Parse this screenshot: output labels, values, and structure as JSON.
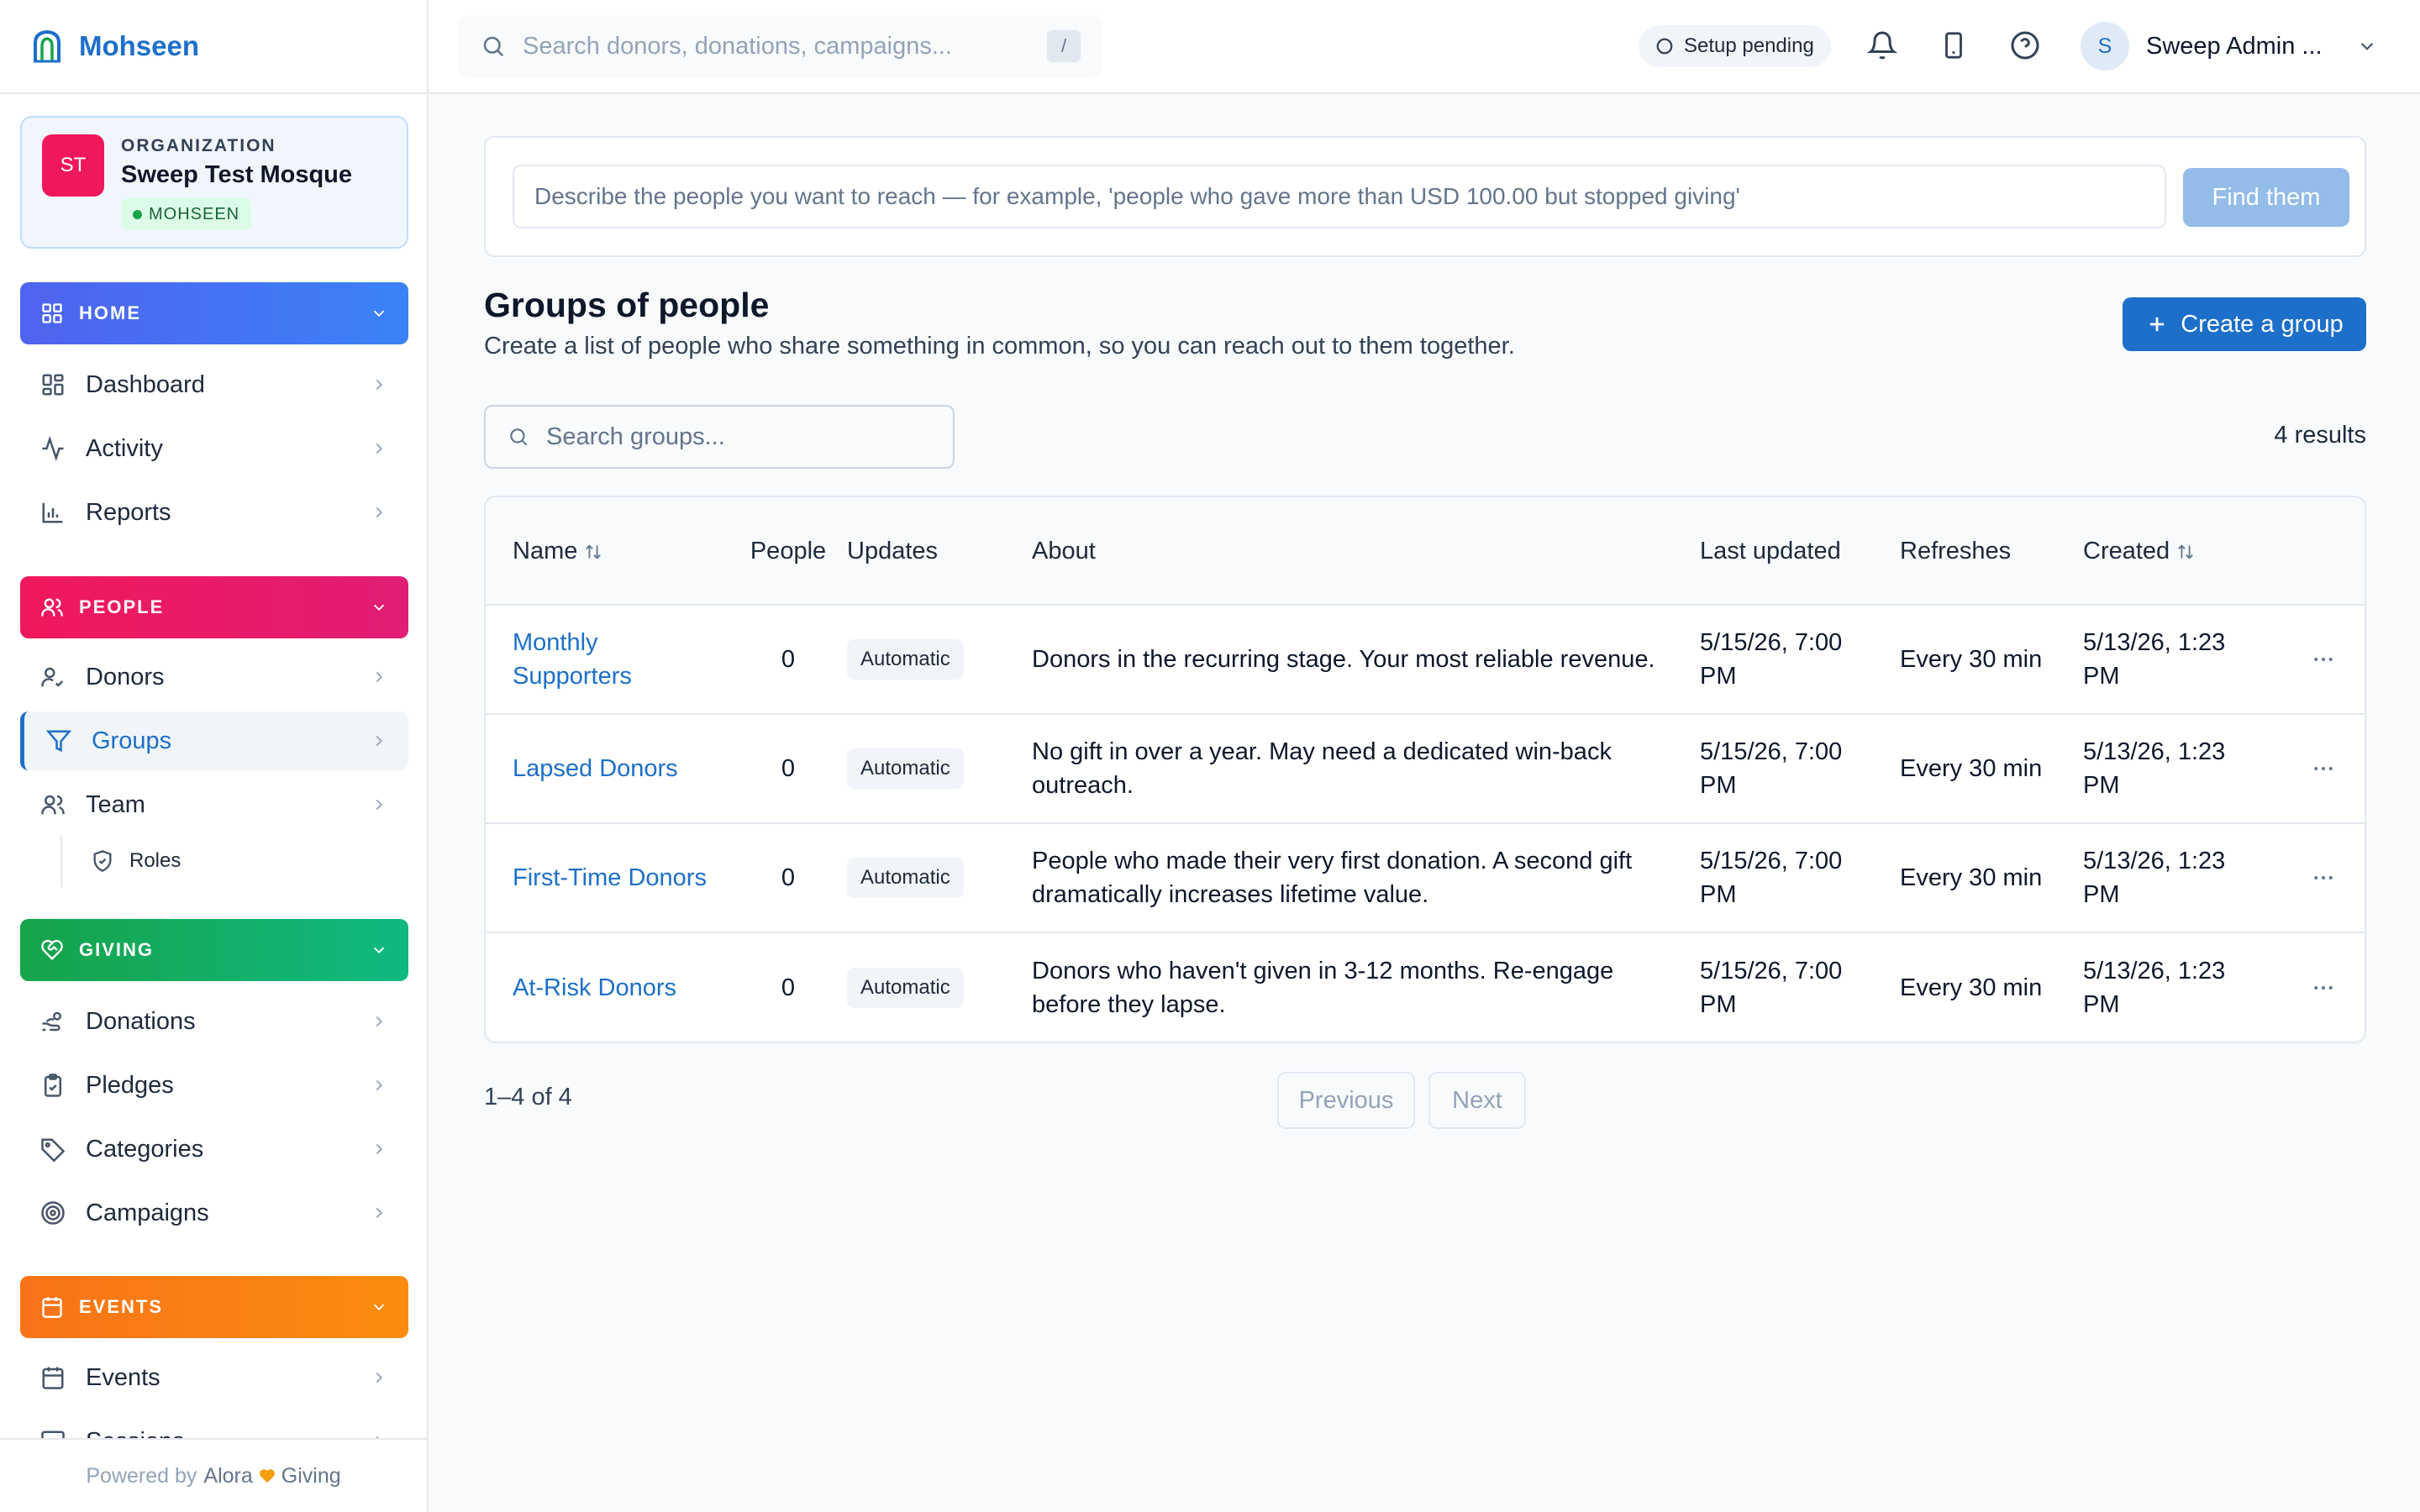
{
  "brand": {
    "name": "Mohseen"
  },
  "org": {
    "initials": "ST",
    "label": "ORGANIZATION",
    "name": "Sweep Test Mosque",
    "badge": "MOHSEEN"
  },
  "colors": {
    "accent": "#1d6fc9",
    "home": "#4f63f0",
    "people": "#f0185c",
    "giving": "#16a34a",
    "events": "#fb7a10"
  },
  "sidebar": {
    "home": {
      "title": "HOME",
      "items": [
        {
          "label": "Dashboard",
          "icon": "grid-icon"
        },
        {
          "label": "Activity",
          "icon": "activity-icon"
        },
        {
          "label": "Reports",
          "icon": "bar-chart-icon"
        }
      ]
    },
    "people": {
      "title": "PEOPLE",
      "items": [
        {
          "label": "Donors",
          "icon": "user-check-icon"
        },
        {
          "label": "Groups",
          "icon": "filter-icon",
          "active": true
        },
        {
          "label": "Team",
          "icon": "users-icon"
        }
      ],
      "sub": [
        {
          "label": "Roles",
          "icon": "shield-icon"
        }
      ]
    },
    "giving": {
      "title": "GIVING",
      "items": [
        {
          "label": "Donations",
          "icon": "hand-coins-icon"
        },
        {
          "label": "Pledges",
          "icon": "clipboard-check-icon"
        },
        {
          "label": "Categories",
          "icon": "tag-icon"
        },
        {
          "label": "Campaigns",
          "icon": "target-icon"
        }
      ]
    },
    "events": {
      "title": "EVENTS",
      "items": [
        {
          "label": "Events",
          "icon": "calendar-icon"
        },
        {
          "label": "Sessions",
          "icon": "monitor-icon"
        }
      ]
    },
    "footer": {
      "prefix": "Powered by",
      "brand1": "Alora",
      "brand2": "Giving"
    }
  },
  "topbar": {
    "search_placeholder": "Search donors, donations, campaigns...",
    "search_shortcut": "/",
    "setup_status": "Setup pending",
    "user_initial": "S",
    "user_name": "Sweep Admin ..."
  },
  "ai_search": {
    "placeholder": "Describe the people you want to reach — for example, 'people who gave more than USD 100.00 but stopped giving'",
    "button": "Find them"
  },
  "page": {
    "title": "Groups of people",
    "subtitle": "Create a list of people who share something in common, so you can reach out to them together.",
    "create_button": "Create a group",
    "search_placeholder": "Search groups...",
    "results": "4 results"
  },
  "table": {
    "headers": {
      "name": "Name",
      "people": "People",
      "updates": "Updates",
      "about": "About",
      "last_updated": "Last updated",
      "refreshes": "Refreshes",
      "created": "Created"
    },
    "rows": [
      {
        "name": "Monthly Supporters",
        "people": "0",
        "updates": "Automatic",
        "about": "Donors in the recurring stage. Your most reliable revenue.",
        "last_updated": "5/15/26, 7:00 PM",
        "refreshes": "Every 30 min",
        "created": "5/13/26, 1:23 PM"
      },
      {
        "name": "Lapsed Donors",
        "people": "0",
        "updates": "Automatic",
        "about": "No gift in over a year. May need a dedicated win-back outreach.",
        "last_updated": "5/15/26, 7:00 PM",
        "refreshes": "Every 30 min",
        "created": "5/13/26, 1:23 PM"
      },
      {
        "name": "First-Time Donors",
        "people": "0",
        "updates": "Automatic",
        "about": "People who made their very first donation. A second gift dramatically increases lifetime value.",
        "last_updated": "5/15/26, 7:00 PM",
        "refreshes": "Every 30 min",
        "created": "5/13/26, 1:23 PM"
      },
      {
        "name": "At-Risk Donors",
        "people": "0",
        "updates": "Automatic",
        "about": "Donors who haven't given in 3-12 months. Re-engage before they lapse.",
        "last_updated": "5/15/26, 7:00 PM",
        "refreshes": "Every 30 min",
        "created": "5/13/26, 1:23 PM"
      }
    ]
  },
  "pagination": {
    "info": "1–4 of 4",
    "previous": "Previous",
    "next": "Next"
  }
}
